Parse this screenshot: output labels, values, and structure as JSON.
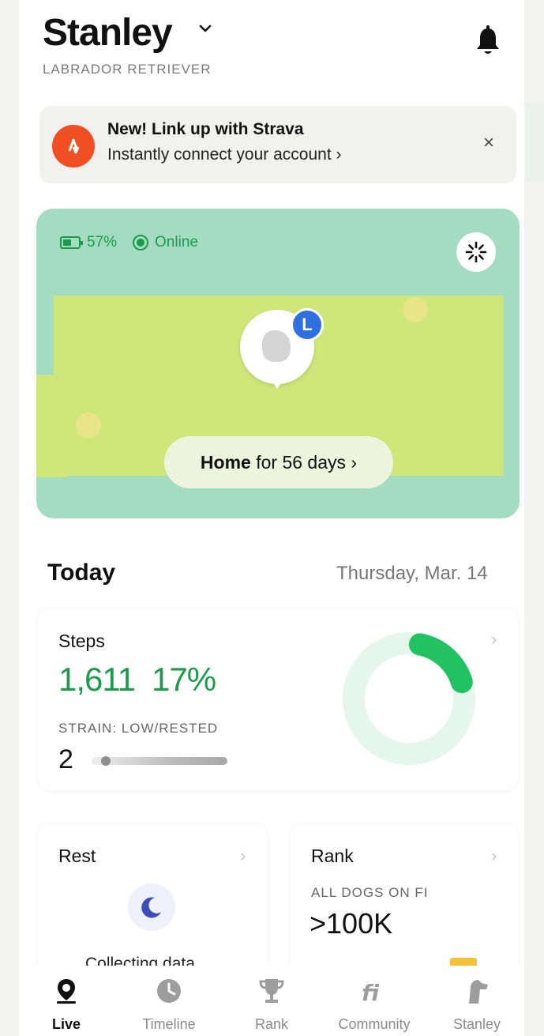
{
  "header": {
    "dog_name": "Stanley",
    "breed": "LABRADOR RETRIEVER"
  },
  "banner": {
    "title": "New! Link up with Strava",
    "subtitle": "Instantly connect your account ›",
    "close": "×"
  },
  "map_card": {
    "battery": "57%",
    "connection": "Online",
    "owner_initial": "L",
    "home_prefix": "Home",
    "home_suffix": " for 56 days ›"
  },
  "today": {
    "label": "Today",
    "date": "Thursday, Mar. 14",
    "steps": {
      "title": "Steps",
      "value": "1,611",
      "percent": "17%",
      "goal_progress": 0.17,
      "strain_label": "STRAIN: LOW/RESTED",
      "strain_value": "2",
      "chevron": "›"
    },
    "rest": {
      "title": "Rest",
      "status": "Collecting data",
      "chevron": "›"
    },
    "rank": {
      "title": "Rank",
      "subtitle": "ALL DOGS ON FI",
      "value": ">100K",
      "chevron": "›"
    }
  },
  "tabs": [
    {
      "label": "Live",
      "icon": "location-pin-icon",
      "active": true
    },
    {
      "label": "Timeline",
      "icon": "clock-icon",
      "active": false
    },
    {
      "label": "Rank",
      "icon": "trophy-icon",
      "active": false
    },
    {
      "label": "Community",
      "icon": "fi-logo-icon",
      "active": false
    },
    {
      "label": "Stanley",
      "icon": "dog-profile-icon",
      "active": false
    }
  ],
  "colors": {
    "accent_green": "#1e9a4d",
    "strava_orange": "#f04e23",
    "map_green": "#a3dcc0",
    "yard_yellow": "#cfe77a",
    "badge_blue": "#2f6fde"
  }
}
